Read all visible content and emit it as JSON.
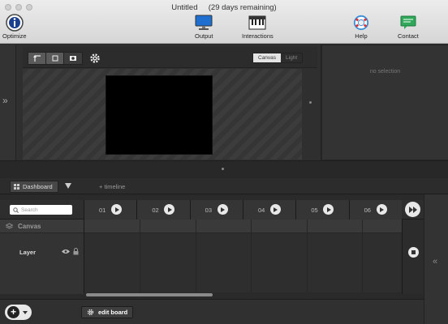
{
  "window": {
    "title": "Untitled",
    "trial": "(29 days remaining)"
  },
  "toolbar": {
    "optimize": "Optimize",
    "output": "Output",
    "interactions": "Interactions",
    "help": "Help",
    "contact": "Contact"
  },
  "stage": {
    "tools": [
      "select-arrows-icon",
      "crop-icon",
      "record-icon"
    ],
    "toggle": {
      "canvas": "Canvas",
      "light": "Light",
      "selected": "Canvas"
    }
  },
  "inspector": {
    "empty_text": "no selection"
  },
  "dashboard": {
    "tab_label": "Dashboard",
    "timeline_link": "+ timeline"
  },
  "timeline": {
    "search_placeholder": "Search",
    "frames": [
      "01",
      "02",
      "03",
      "04",
      "05",
      "06"
    ],
    "canvas_label": "Canvas",
    "layer_label": "Layer"
  },
  "footer": {
    "edit_board_label": "edit board"
  },
  "colors": {
    "toolbar_bg": "#e0e0e0",
    "panel_bg": "#2f2f2f",
    "accent_green": "#2fa85a",
    "accent_blue": "#1f6fd1"
  }
}
